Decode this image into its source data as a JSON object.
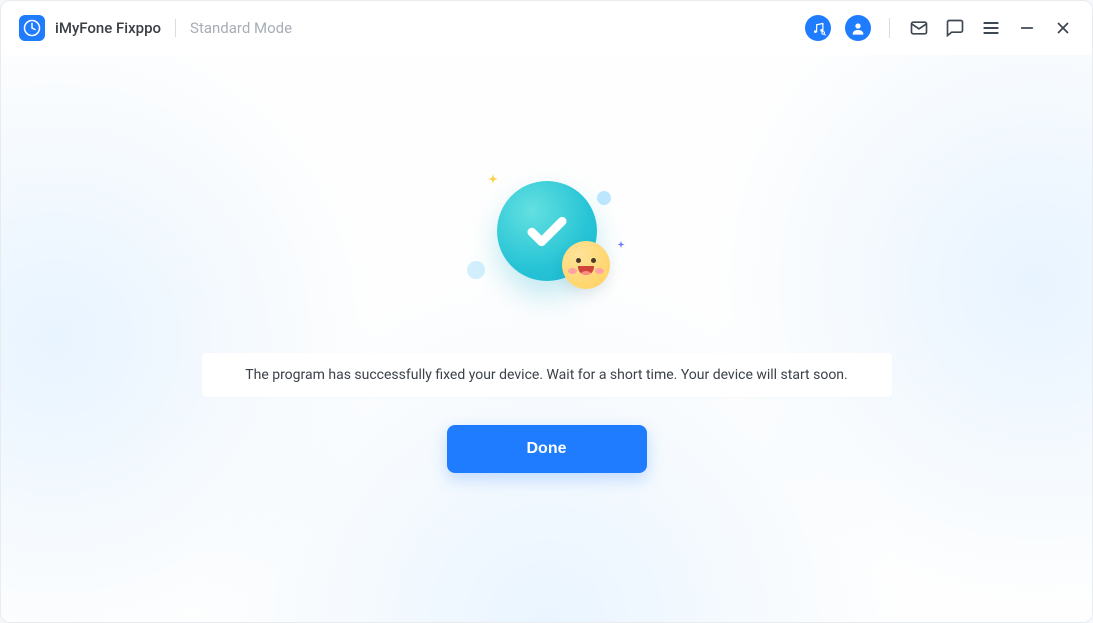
{
  "app": {
    "name": "iMyFone Fixppo",
    "mode": "Standard Mode"
  },
  "status": {
    "message": "The program has successfully fixed your device. Wait for a short time. Your device will start soon."
  },
  "actions": {
    "done": "Done"
  },
  "colors": {
    "accent": "#1f7cff"
  }
}
